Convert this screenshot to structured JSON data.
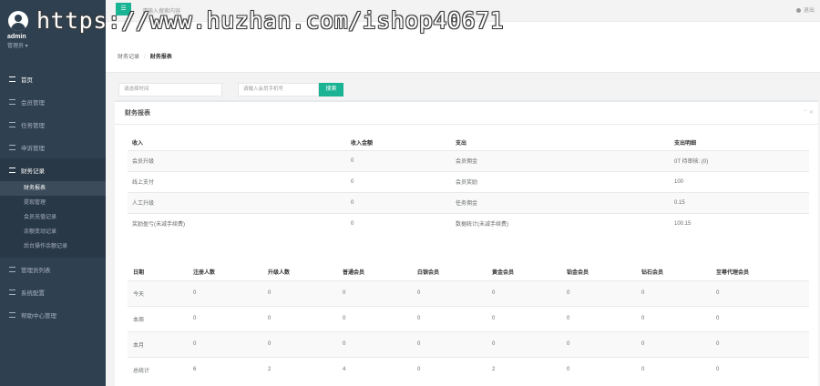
{
  "watermark": "https://www.huzhan.com/ishop40671",
  "profile": {
    "name": "admin",
    "role": "管理员 ▾"
  },
  "nav": {
    "home": "首页",
    "members": "会员管理",
    "tasks": "任务管理",
    "appeals": "申诉管理",
    "finance": "财务记录",
    "finance_sub": [
      "财务报表",
      "提现管理",
      "会员充值记录",
      "余额变动记录",
      "后台操作余额记录"
    ],
    "admins": "管理员列表",
    "settings": "系统配置",
    "help": "帮助中心管理"
  },
  "topbar": {
    "menu_icon": "☰",
    "search_placeholder": "请输入搜索内容",
    "logout": "退出"
  },
  "breadcrumb": {
    "parent": "财务记录",
    "current": "财务报表"
  },
  "filter": {
    "time_placeholder": "请选择时间",
    "phone_placeholder": "请输入会员手机号",
    "search_button": "搜索"
  },
  "panel": {
    "title": "财务报表",
    "tools": "⌃ ✕"
  },
  "summary_table": {
    "headers": [
      "收入",
      "收入金额",
      "支出",
      "支出明细"
    ],
    "rows": [
      [
        "会员升级",
        "0",
        "会员佣金",
        "0T 待审核: (0)"
      ],
      [
        "线上支付",
        "0",
        "会员奖励",
        "100"
      ],
      [
        "人工升级",
        "0",
        "任务佣金",
        "0.15"
      ],
      [
        "奖励盈亏(未减手续费)",
        "0",
        "数据统计(未减手续费)",
        "100.15"
      ]
    ]
  },
  "stats_table": {
    "headers": [
      "日期",
      "注册人数",
      "升级人数",
      "普通会员",
      "白银会员",
      "黄金会员",
      "铂金会员",
      "钻石会员",
      "至尊代理会员"
    ],
    "rows": [
      [
        "今天",
        "0",
        "0",
        "0",
        "0",
        "0",
        "0",
        "0",
        "0"
      ],
      [
        "本周",
        "0",
        "0",
        "0",
        "0",
        "0",
        "0",
        "0",
        "0"
      ],
      [
        "本月",
        "0",
        "0",
        "0",
        "0",
        "0",
        "0",
        "0",
        "0"
      ],
      [
        "总统计",
        "6",
        "2",
        "4",
        "0",
        "2",
        "0",
        "0",
        "0"
      ]
    ]
  }
}
